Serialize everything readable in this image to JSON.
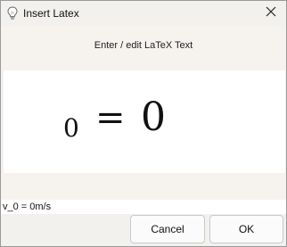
{
  "window": {
    "title": "Insert Latex",
    "app_icon": "lightbulb-icon",
    "close_icon": "close-icon"
  },
  "instructions": "Enter / edit LaTeX Text",
  "preview": {
    "subscript": "0",
    "equals": "=",
    "rhs": "0"
  },
  "input": {
    "value": "v_0 = 0m/s"
  },
  "buttons": {
    "cancel_label": "Cancel",
    "ok_label": "OK"
  }
}
